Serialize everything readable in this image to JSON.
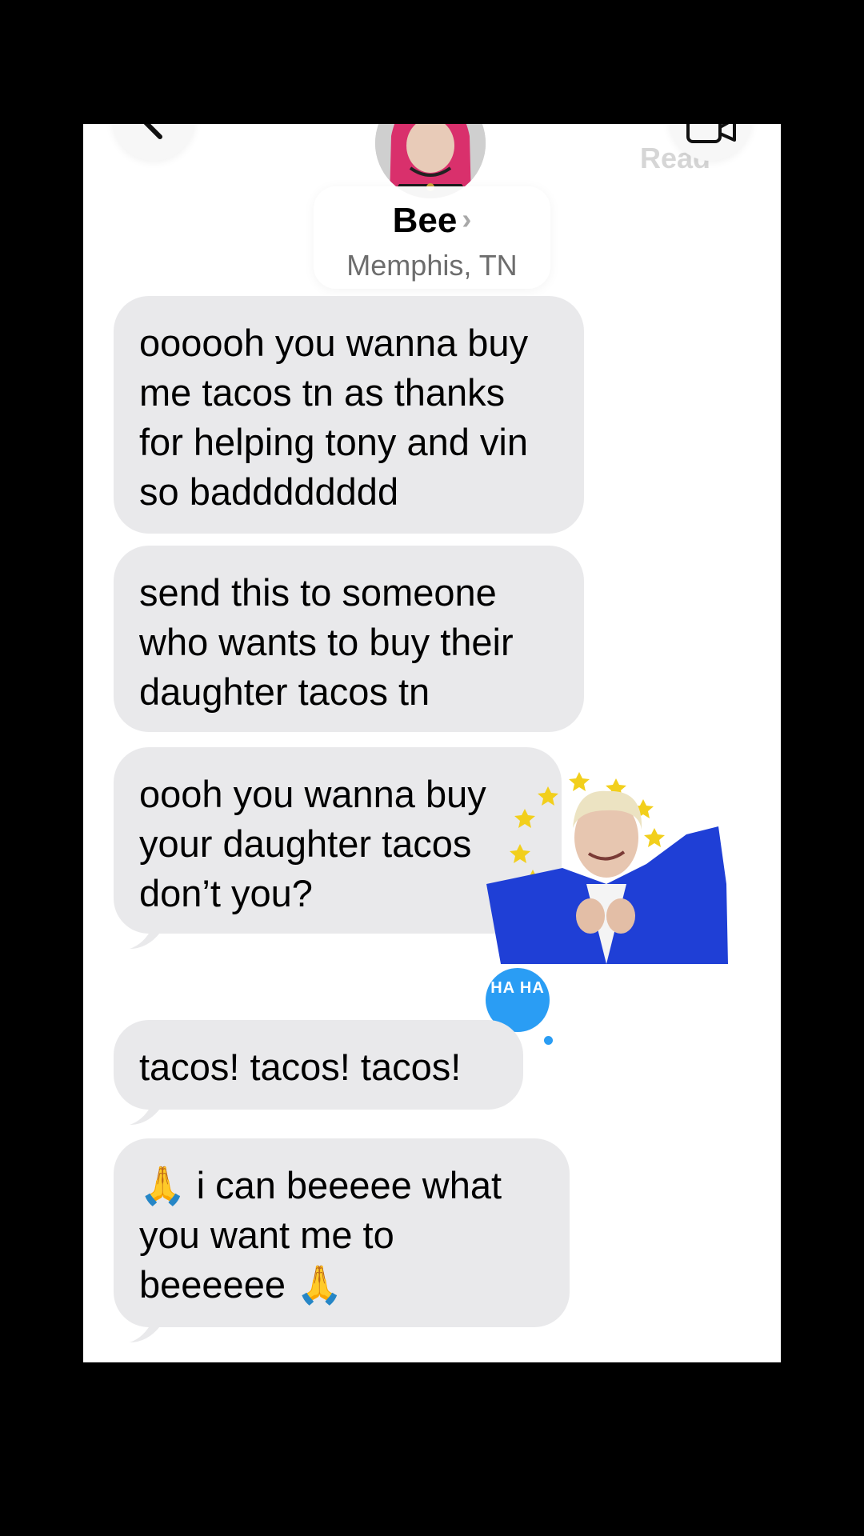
{
  "header": {
    "contact_name": "Bee",
    "contact_location": "Memphis, TN",
    "read_label": "Read",
    "back_icon": "chevron-left-icon",
    "video_icon": "video-camera-icon"
  },
  "messages": [
    {
      "text": "oooooh you wanna buy me tacos tn as thanks for helping tony and vin so badddddddd"
    },
    {
      "text": "send this to someone who wants to buy their daughter tacos tn"
    },
    {
      "text": "oooh you wanna buy your daughter tacos don’t you?"
    },
    {
      "text": "tacos! tacos! tacos!",
      "reaction": "HA HA"
    },
    {
      "text": "🙏 i can beeeee what you want me to beeeeee 🙏"
    }
  ],
  "colors": {
    "incoming_bubble": "#e9e9eb",
    "reaction_blue": "#2a9df4",
    "sticker_suit_blue": "#1f3fd6",
    "sticker_star_yellow": "#f2cf1c"
  }
}
